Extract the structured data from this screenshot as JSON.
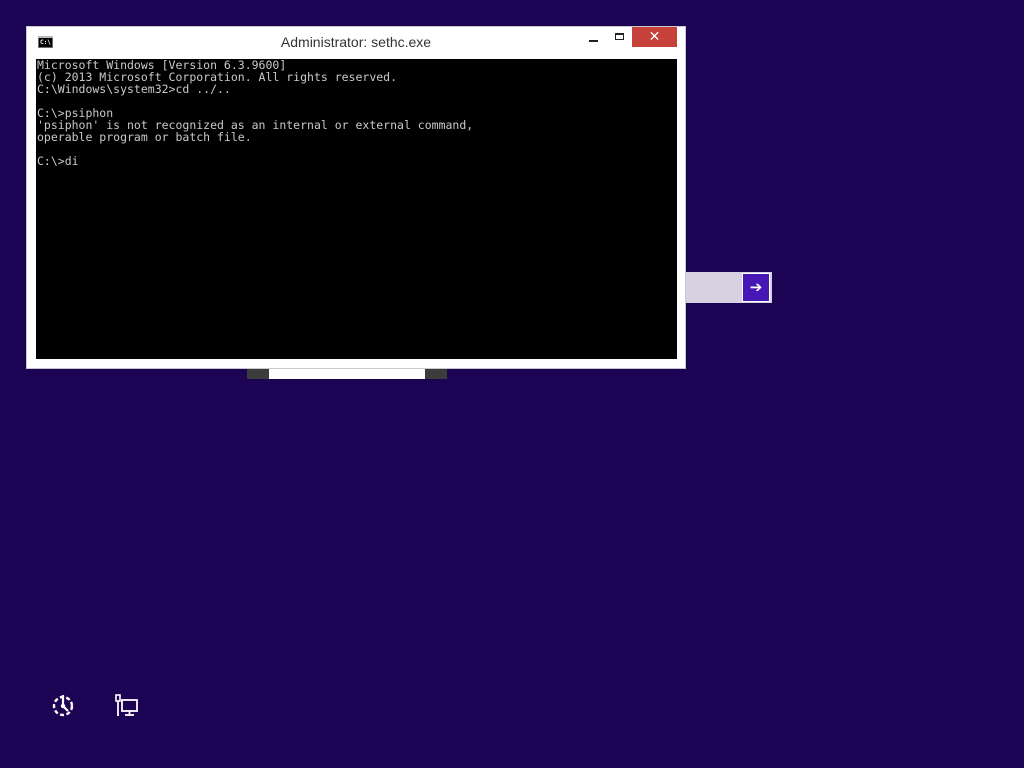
{
  "window": {
    "title": "Administrator: sethc.exe",
    "icon_label": "C:\\",
    "close_glyph": "✕"
  },
  "console": {
    "lines": [
      "Microsoft Windows [Version 6.3.9600]",
      "(c) 2013 Microsoft Corporation. All rights reserved.",
      "C:\\Windows\\system32>cd ../..",
      "",
      "C:\\>psiphon",
      "'psiphon' is not recognized as an internal or external command,",
      "operable program or batch file.",
      "",
      "C:\\>di"
    ]
  },
  "signin": {
    "submit_glyph": "➔"
  },
  "system_icons": [
    "ease-of-access-icon",
    "network-icon"
  ],
  "colors": {
    "background": "#1c0354",
    "accent": "#4617b4",
    "close": "#c7413b"
  }
}
